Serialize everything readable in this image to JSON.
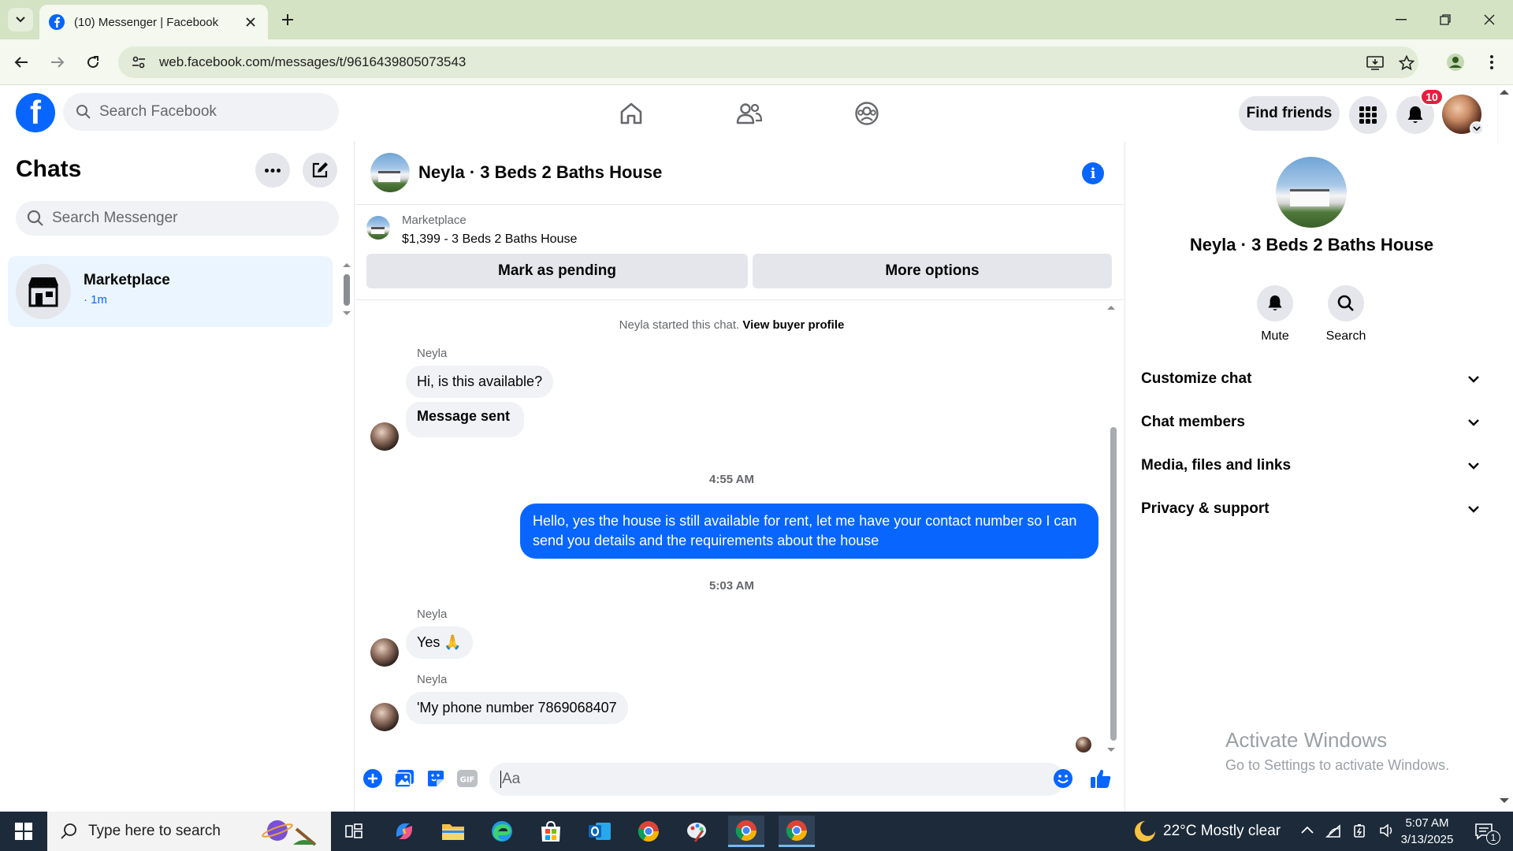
{
  "browser": {
    "tab_title": "(10) Messenger | Facebook",
    "url": "web.facebook.com/messages/t/9616439805073543"
  },
  "fb_header": {
    "logo": "f",
    "search_placeholder": "Search Facebook",
    "find_friends_label": "Find friends",
    "notification_count": "10"
  },
  "chats": {
    "title": "Chats",
    "search_placeholder": "Search Messenger",
    "items": [
      {
        "name": "Marketplace",
        "time": "· 1m"
      }
    ]
  },
  "conversation": {
    "title": "Neyla · 3 Beds 2 Baths House",
    "marketplace": {
      "label": "Marketplace",
      "price_line": "$1,399 - 3 Beds 2 Baths House",
      "mark_pending_label": "Mark as pending",
      "more_options_label": "More options"
    },
    "system_line": "Neyla started this chat.",
    "view_buyer_profile": "View buyer profile",
    "sender_name": "Neyla",
    "messages": [
      {
        "text": "Hi, is this available?"
      },
      {
        "text": "Message sent"
      },
      {
        "timestamp": "4:55 AM"
      },
      {
        "text": "Hello, yes the house is still available for rent, let me have your contact number so I can send you details and the requirements about the house"
      },
      {
        "timestamp": "5:03 AM"
      },
      {
        "text": "Yes 🙏"
      },
      {
        "text": "'My phone number 7869068407"
      }
    ],
    "composer_placeholder": "Aa"
  },
  "details": {
    "name": "Neyla · 3 Beds 2 Baths House",
    "actions": [
      {
        "label": "Mute",
        "icon": "bell-icon"
      },
      {
        "label": "Search",
        "icon": "search-icon"
      }
    ],
    "sections": [
      {
        "label": "Customize chat"
      },
      {
        "label": "Chat members"
      },
      {
        "label": "Media, files and links"
      },
      {
        "label": "Privacy & support"
      }
    ]
  },
  "watermark": {
    "line1": "Activate Windows",
    "line2": "Go to Settings to activate Windows."
  },
  "taskbar": {
    "search_placeholder": "Type here to search",
    "weather": "22°C  Mostly clear",
    "time": "5:07 AM",
    "date": "3/13/2025",
    "notification_count": "1"
  },
  "colors": {
    "facebook_blue": "#0866ff",
    "chrome_tab_strip": "#d3e3c4",
    "taskbar": "#1c2a3a",
    "badge_red": "#e41e3f"
  }
}
